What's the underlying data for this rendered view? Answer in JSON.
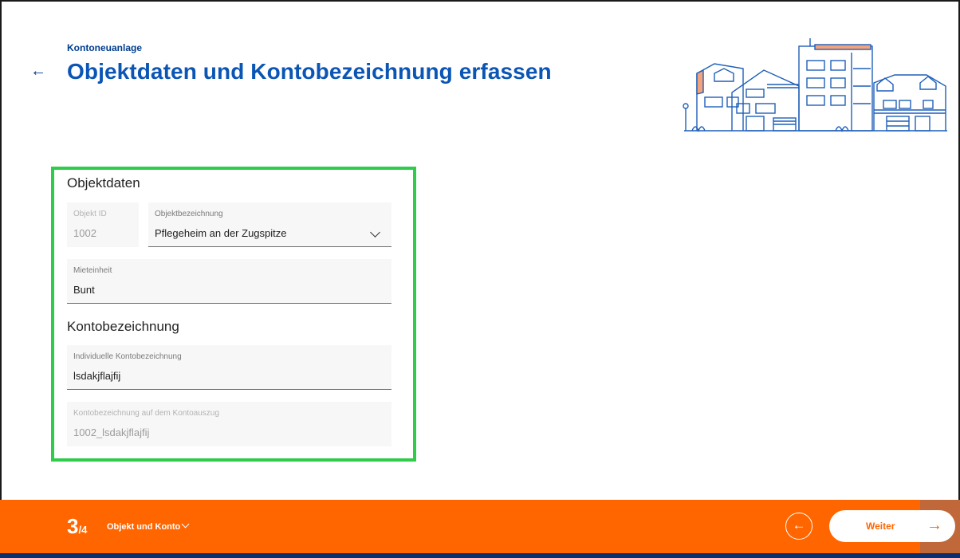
{
  "header": {
    "eyebrow": "Kontoneuanlage",
    "title": "Objektdaten und Kontobezeichnung erfassen",
    "back_icon": "←"
  },
  "form": {
    "objektdaten_title": "Objektdaten",
    "objekt_id": {
      "label": "Objekt ID",
      "value": "1002"
    },
    "objektbezeichnung": {
      "label": "Objektbezeichnung",
      "value": "Pflegeheim an der Zugspitze"
    },
    "mieteinheit": {
      "label": "Mieteinheit",
      "value": "Bunt"
    },
    "kontobezeichnung_title": "Kontobezeichnung",
    "individuelle": {
      "label": "Individuelle Kontobezeichnung",
      "value": "lsdakjflajfij"
    },
    "kontoauszug": {
      "label": "Kontobezeichnung auf dem Kontoauszug",
      "value": "1002_lsdakjflajfij"
    }
  },
  "footer": {
    "step_current": "3",
    "step_total": "/4",
    "step_label": "Objekt und Konto",
    "prev_icon": "←",
    "next_label": "Weiter",
    "next_icon": "→"
  },
  "colors": {
    "brand_blue": "#0b55b5",
    "orange": "#ff6600",
    "highlight_green": "#2ecc4a"
  }
}
